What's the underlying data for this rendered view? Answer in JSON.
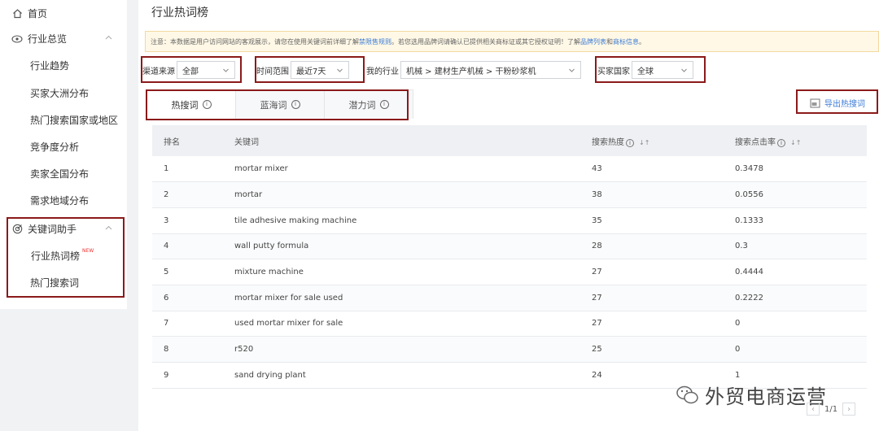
{
  "sidebar": {
    "home": "首页",
    "overview": "行业总览",
    "overview_items": [
      "行业趋势",
      "买家大洲分布",
      "热门搜索国家或地区",
      "竞争度分析",
      "卖家全国分布",
      "需求地域分布"
    ],
    "keyword_helper": "关键词助手",
    "keyword_items": [
      "行业热词榜",
      "热门搜索词"
    ],
    "new_badge": "NEW"
  },
  "main": {
    "title": "行业热词榜",
    "notice": {
      "part1": "注意：本数据是用户访问网站的客观展示，请您在使用关键词前详细了解",
      "link1": "禁限售规则",
      "part2": "。若您选用品牌词请确认已提供相关商标证或其它授权证明！了解",
      "link2": "品牌列表",
      "part3": "和",
      "link3": "商标信息",
      "part4": "。"
    },
    "filters": {
      "channel_label": "渠道来源",
      "channel_value": "全部",
      "time_label": "时间范围",
      "time_value": "最近7天",
      "industry_label": "我的行业",
      "industry_value": "机械 > 建材生产机械 > 干粉砂浆机",
      "country_label": "买家国家",
      "country_value": "全球"
    },
    "tabs": [
      "热搜词",
      "蓝海词",
      "潜力词"
    ],
    "export_label": "导出热搜词",
    "table": {
      "headers": [
        "排名",
        "关键词",
        "搜索热度",
        "搜索点击率"
      ],
      "rows": [
        [
          "1",
          "mortar mixer",
          "43",
          "0.3478"
        ],
        [
          "2",
          "mortar",
          "38",
          "0.0556"
        ],
        [
          "3",
          "tile adhesive making machine",
          "35",
          "0.1333"
        ],
        [
          "4",
          "wall putty formula",
          "28",
          "0.3"
        ],
        [
          "5",
          "mixture machine",
          "27",
          "0.4444"
        ],
        [
          "6",
          "mortar mixer for sale used",
          "27",
          "0.2222"
        ],
        [
          "7",
          "used mortar mixer for sale",
          "27",
          "0"
        ],
        [
          "8",
          "r520",
          "25",
          "0"
        ],
        [
          "9",
          "sand drying plant",
          "24",
          "1"
        ]
      ]
    },
    "pager": "1/1",
    "watermark": "外贸电商运营"
  },
  "colors": {
    "accent": "#3b7bd6",
    "highlight_box": "#8b1a1a",
    "active_bar": "#e8a23a"
  }
}
